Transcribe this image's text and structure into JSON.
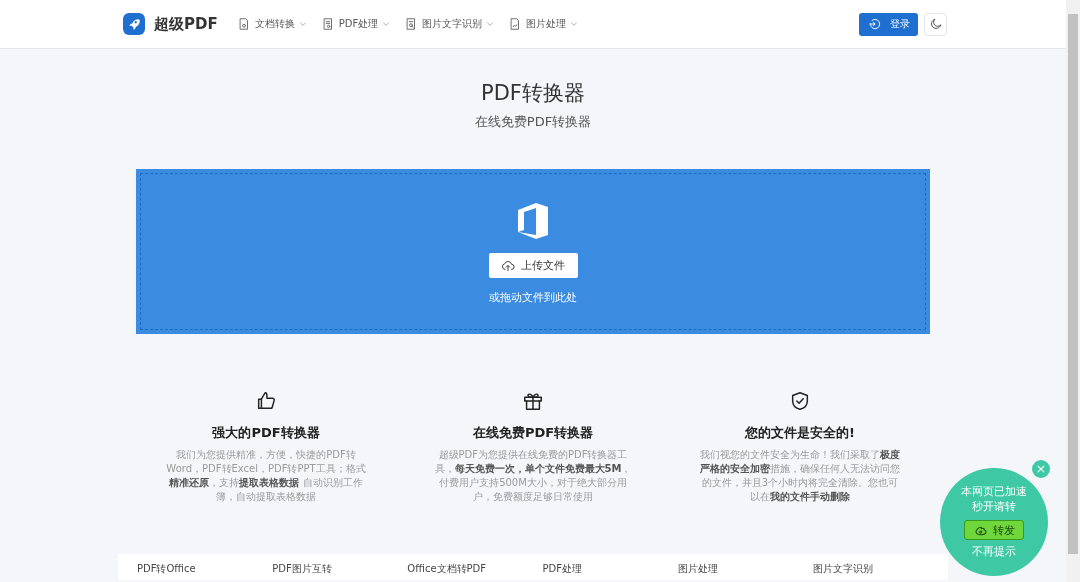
{
  "header": {
    "logo": "超级PDF",
    "menu": [
      {
        "label": "文档转换"
      },
      {
        "label": "PDF处理"
      },
      {
        "label": "图片文字识别"
      },
      {
        "label": "图片处理"
      }
    ],
    "login": "登录"
  },
  "hero": {
    "title": "PDF转换器",
    "subtitle": "在线免费PDF转换器"
  },
  "upload": {
    "button": "上传文件",
    "hint": "或拖动文件到此处"
  },
  "features": [
    {
      "title": "强大的PDF转换器",
      "text": "我们为您提供精准，方便，快捷的PDF转Word，PDF转Excel，PDF转PPT工具；格式**精准还原**，支持**提取表格数据** 自动识别工作簿，自动提取表格数据"
    },
    {
      "title": "在线免费PDF转换器",
      "text": "超级PDF为您提供在线免费的PDF转换器工具，**每天免费一次，单个文件免费最大5M**，付费用户支持500M大小，对于绝大部分用户，免费额度足够日常使用"
    },
    {
      "title": "您的文件是安全的!",
      "text": "我们视您的文件安全为生命！我们采取了**极度严格的安全加密**措施，确保任何人无法访问您的文件，并且3个小时内将完全清除。您也可以在**我的文件手动删除**"
    }
  ],
  "categories": [
    "PDF转Office",
    "PDF图片互转",
    "Office文档转PDF",
    "PDF处理",
    "图片处理",
    "图片文字识别"
  ],
  "popup": {
    "message": [
      "本网页已加速",
      "秒开请转"
    ],
    "share": "转发",
    "dismiss": "不再提示",
    "close": "×"
  }
}
